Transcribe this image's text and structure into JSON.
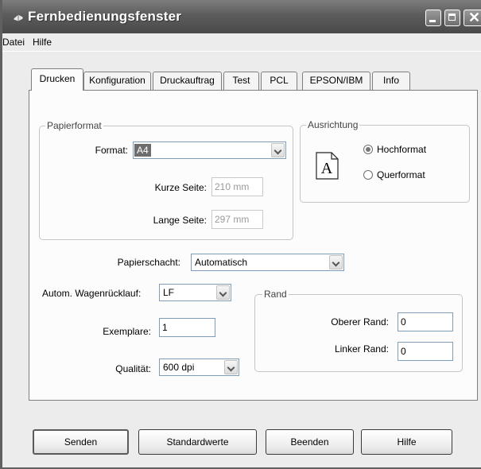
{
  "window": {
    "title": "Fernbedienungsfenster"
  },
  "menu": {
    "items": [
      "Datei",
      "Hilfe"
    ]
  },
  "tabs": [
    "Drucken",
    "Konfiguration",
    "Druckauftrag",
    "Test",
    "PCL",
    "EPSON/IBM",
    "Info"
  ],
  "active_tab": "Drucken",
  "papierformat": {
    "group_title": "Papierformat",
    "format_label": "Format:",
    "format_value": "A4",
    "kurze_label": "Kurze Seite:",
    "kurze_value": "210 mm",
    "lange_label": "Lange Seite:",
    "lange_value": "297 mm"
  },
  "ausrichtung": {
    "group_title": "Ausrichtung",
    "icon_letter": "A",
    "options": [
      "Hochformat",
      "Querformat"
    ],
    "selected": "Hochformat"
  },
  "papierschacht": {
    "label": "Papierschacht:",
    "value": "Automatisch"
  },
  "wagenruecklauf": {
    "label": "Autom. Wagenrücklauf:",
    "value": "LF"
  },
  "exemplare": {
    "label": "Exemplare:",
    "value": "1"
  },
  "qualitaet": {
    "label": "Qualität:",
    "value": "600 dpi"
  },
  "rand": {
    "group_title": "Rand",
    "oberer_label": "Oberer Rand:",
    "oberer_value": "0",
    "linker_label": "Linker Rand:",
    "linker_value": "0"
  },
  "buttons": {
    "senden": "Senden",
    "standardwerte": "Standardwerte",
    "beenden": "Beenden",
    "hilfe": "Hilfe"
  }
}
